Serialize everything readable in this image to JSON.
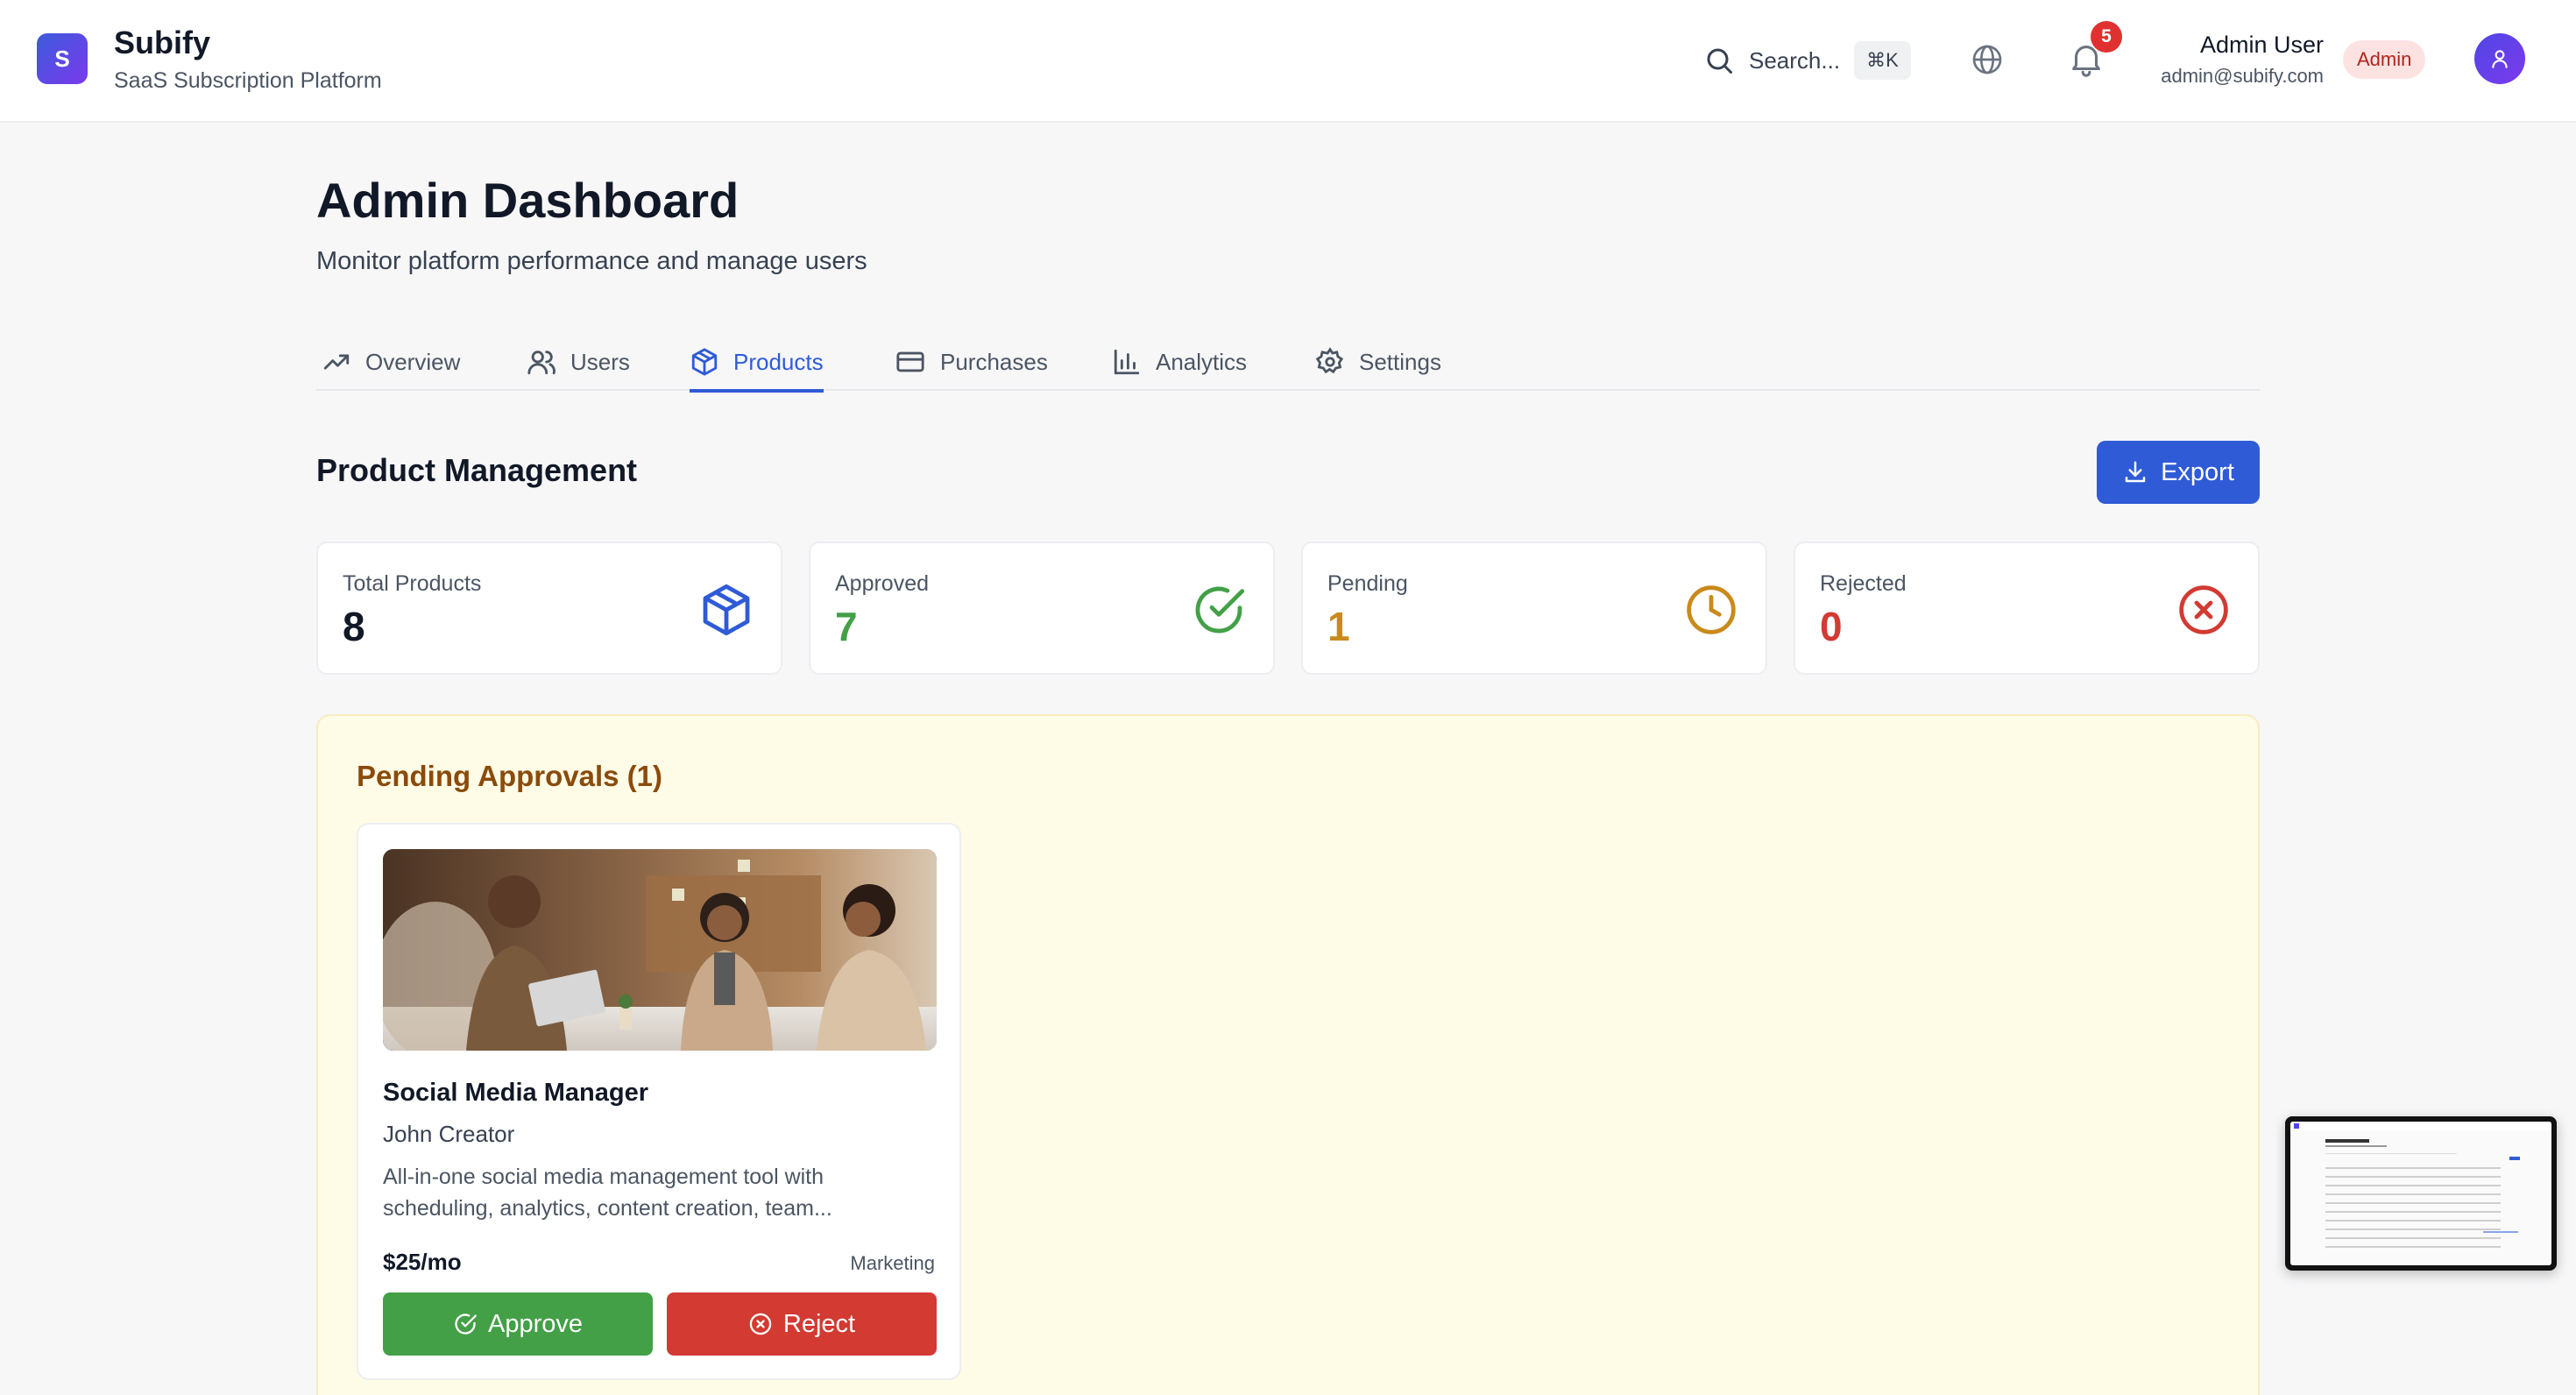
{
  "brand": {
    "logo_letter": "S",
    "name": "Subify",
    "subtitle": "SaaS Subscription Platform"
  },
  "header": {
    "search_label": "Search...",
    "search_shortcut": "⌘K",
    "notifications_count": "5",
    "user_name": "Admin User",
    "user_email": "admin@subify.com",
    "role_badge": "Admin"
  },
  "page": {
    "title": "Admin Dashboard",
    "subtitle": "Monitor platform performance and manage users"
  },
  "tabs": [
    {
      "label": "Overview",
      "icon": "trending-up-icon"
    },
    {
      "label": "Users",
      "icon": "users-icon"
    },
    {
      "label": "Products",
      "icon": "package-icon",
      "active": true
    },
    {
      "label": "Purchases",
      "icon": "credit-card-icon"
    },
    {
      "label": "Analytics",
      "icon": "bar-chart-icon"
    },
    {
      "label": "Settings",
      "icon": "gear-icon"
    }
  ],
  "section": {
    "title": "Product Management",
    "export_label": "Export"
  },
  "stats": [
    {
      "label": "Total Products",
      "value": "8",
      "color": "#111827",
      "icon": "package-icon",
      "icon_color": "#2f5bd7"
    },
    {
      "label": "Approved",
      "value": "7",
      "color": "#43a047",
      "icon": "check-circle-icon",
      "icon_color": "#43a047"
    },
    {
      "label": "Pending",
      "value": "1",
      "color": "#c98a1b",
      "icon": "clock-icon",
      "icon_color": "#c98a1b"
    },
    {
      "label": "Rejected",
      "value": "0",
      "color": "#d23a32",
      "icon": "x-circle-icon",
      "icon_color": "#d23a32"
    }
  ],
  "pending": {
    "title": "Pending Approvals (1)",
    "products": [
      {
        "name": "Social Media Manager",
        "author": "John Creator",
        "description": "All-in-one social media management tool with scheduling, analytics, content creation, team...",
        "price": "$25/mo",
        "category": "Marketing",
        "approve_label": "Approve",
        "reject_label": "Reject"
      }
    ]
  },
  "colors": {
    "accent": "#2f5bd7",
    "approve": "#43a047",
    "reject": "#d23a32",
    "pending_bg": "#fefbe6"
  }
}
